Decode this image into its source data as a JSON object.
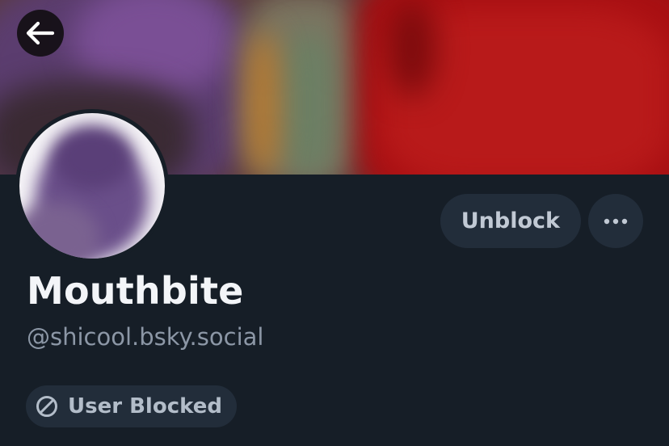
{
  "header": {
    "back_icon": "arrow-left-icon"
  },
  "profile": {
    "display_name": "Mouthbite",
    "handle": "@shicool.bsky.social",
    "avatar": "blurred-avatar"
  },
  "actions": {
    "unblock_label": "Unblock",
    "more_icon": "ellipsis-icon"
  },
  "status": {
    "icon": "block-circle-icon",
    "label": "User Blocked"
  },
  "colors": {
    "background": "#161e27",
    "button_bg": "#222d3a",
    "name_text": "#f3f5f8",
    "handle_text": "#8c97a6"
  }
}
